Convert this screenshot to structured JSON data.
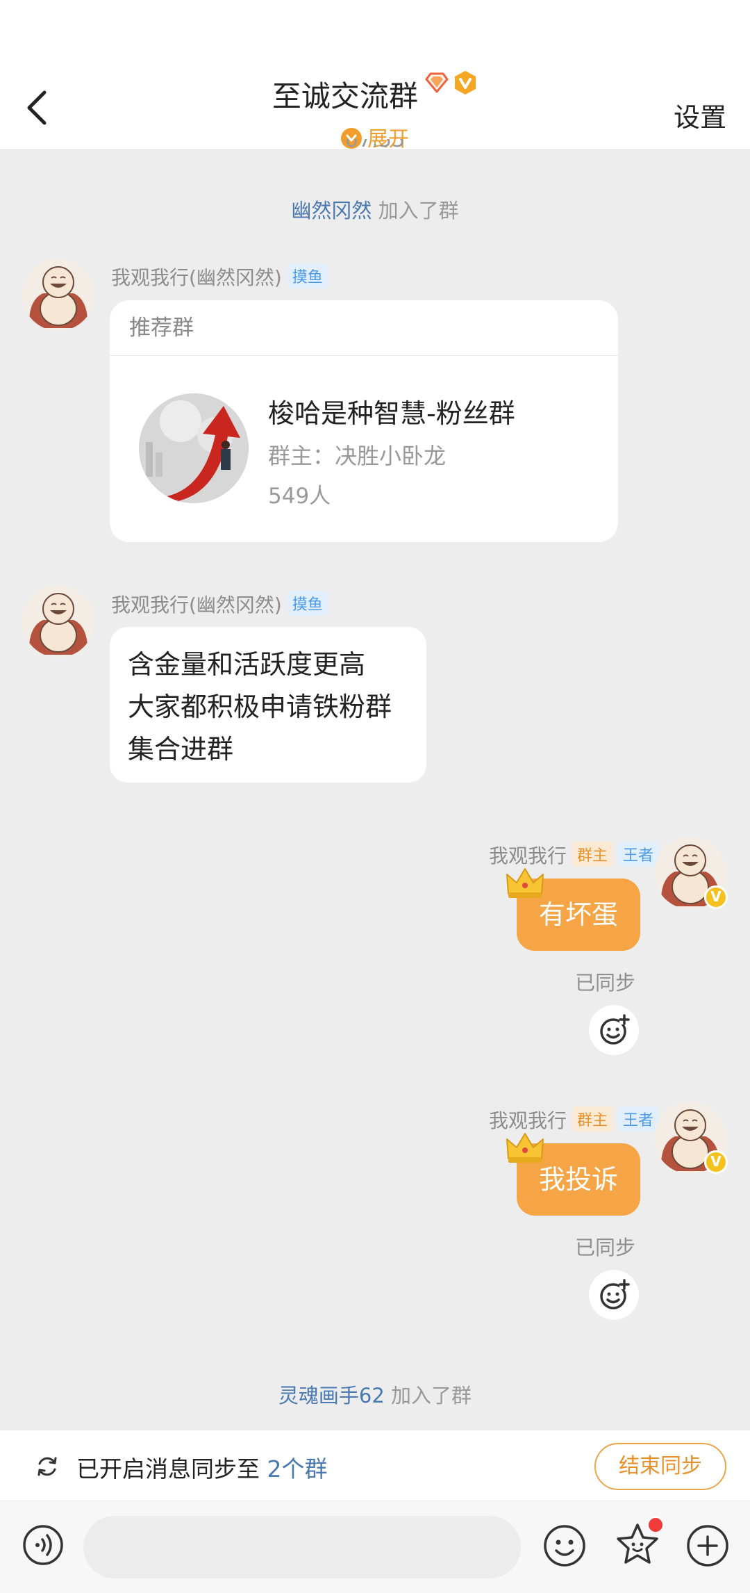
{
  "header": {
    "title": "至诚交流群",
    "expand_label": "展开",
    "settings_label": "设置",
    "peek_time": "07:55"
  },
  "messages": {
    "sys_join_1": {
      "user": "幽然冈然",
      "action": "加入了群"
    },
    "msg1": {
      "sender": "我观我行(幽然冈然)",
      "tag": "摸鱼",
      "card": {
        "header": "推荐群",
        "group_name": "梭哈是种智慧-粉丝群",
        "owner": "群主：决胜小卧龙",
        "members": "549人"
      }
    },
    "msg2": {
      "sender": "我观我行(幽然冈然)",
      "tag": "摸鱼",
      "lines": [
        "含金量和活跃度更高",
        "大家都积极申请铁粉群",
        "集合进群"
      ]
    },
    "msg3": {
      "sender": "我观我行",
      "tag_role": "群主",
      "tag_rank": "王者",
      "text": "有坏蛋",
      "status": "已同步"
    },
    "msg4": {
      "sender": "我观我行",
      "tag_role": "群主",
      "tag_rank": "王者",
      "text": "我投诉",
      "status": "已同步"
    },
    "sys_join_2": {
      "user": "灵魂画手62",
      "action": "加入了群"
    }
  },
  "sync_bar": {
    "text_prefix": "已开启消息同步至",
    "text_link": "2个群",
    "end_button": "结束同步"
  },
  "input_bar": {
    "placeholder": ""
  },
  "colors": {
    "accent_orange": "#f5a545",
    "link_blue": "#4a78b0",
    "background": "#ededed"
  }
}
